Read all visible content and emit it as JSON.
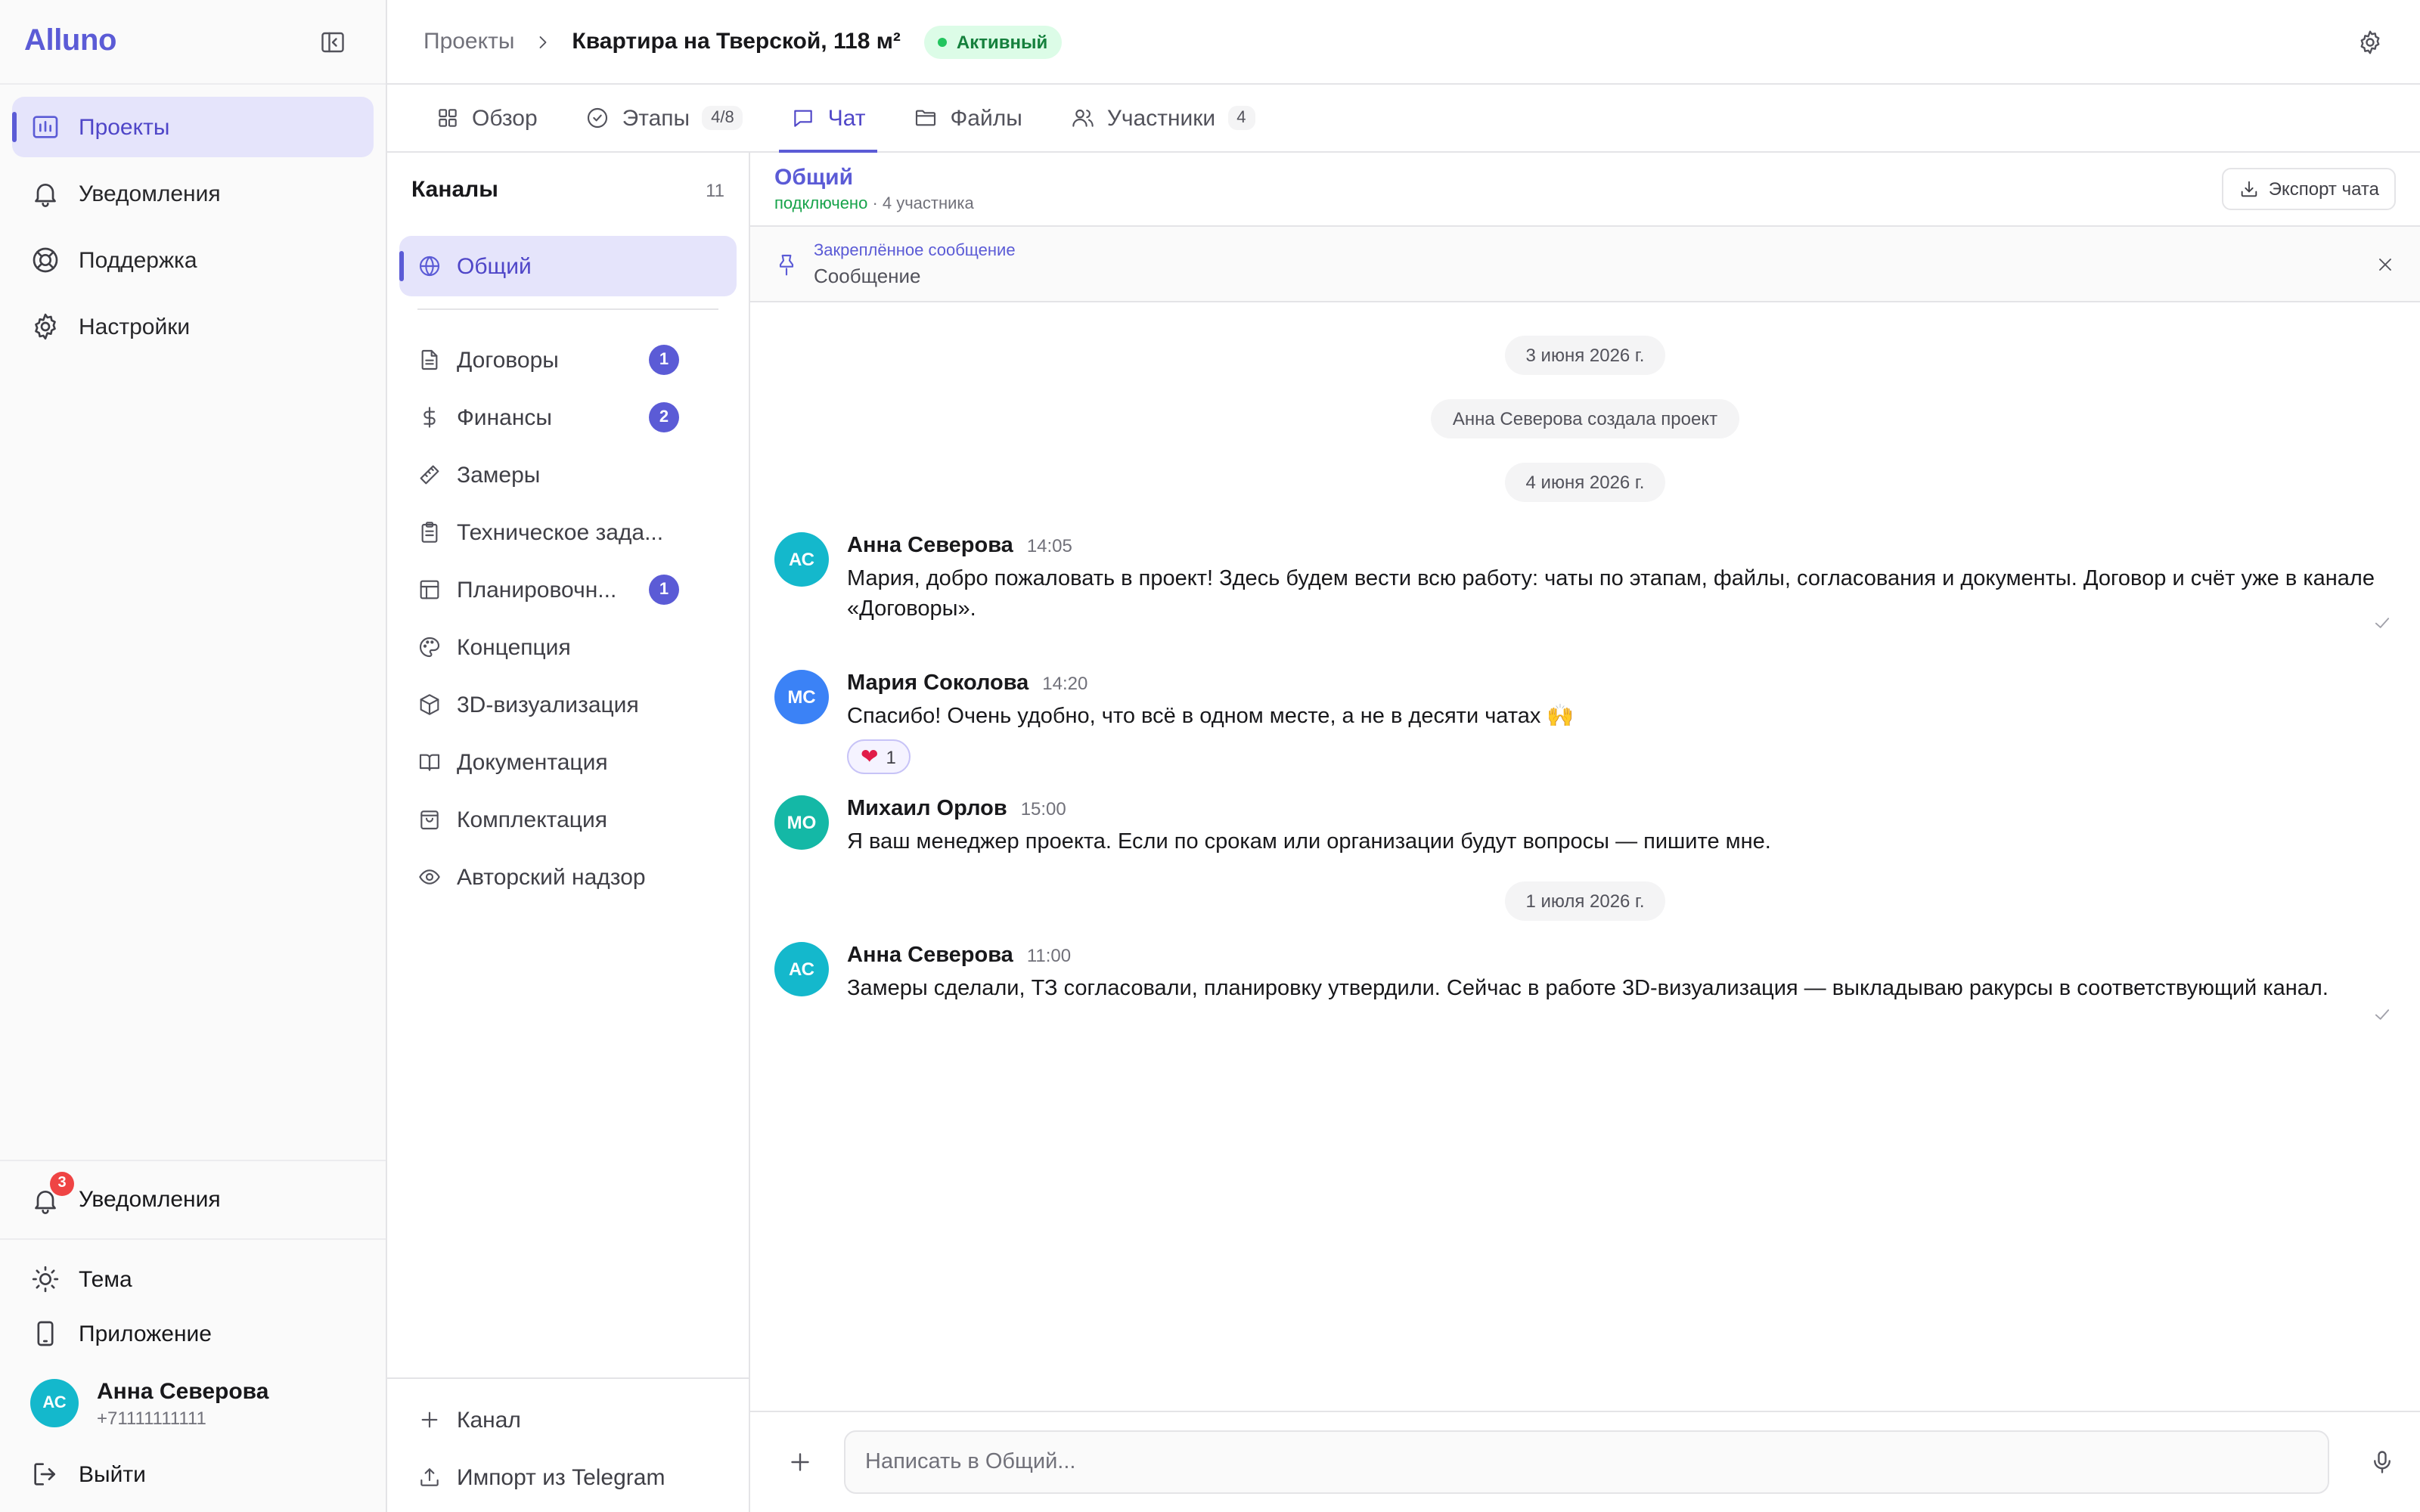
{
  "app": {
    "logo": "Alluno"
  },
  "sidebar": {
    "nav": [
      {
        "label": "Проекты",
        "icon": "chart-board-icon",
        "active": true
      },
      {
        "label": "Уведомления",
        "icon": "bell-icon"
      },
      {
        "label": "Поддержка",
        "icon": "lifebuoy-icon"
      },
      {
        "label": "Настройки",
        "icon": "gear-icon"
      }
    ],
    "notifications": {
      "label": "Уведомления",
      "count": "3"
    },
    "theme_label": "Тема",
    "app_label": "Приложение",
    "user": {
      "initials": "АС",
      "name": "Анна Северова",
      "phone": "+71111111111",
      "avatar_color": "#14b8cc"
    },
    "logout_label": "Выйти"
  },
  "header": {
    "breadcrumb_parent": "Проекты",
    "project_title": "Квартира на Тверской, 118 м²",
    "status": "Активный"
  },
  "tabs": [
    {
      "label": "Обзор",
      "icon": "grid-icon"
    },
    {
      "label": "Этапы",
      "icon": "check-circle-icon",
      "count": "4/8"
    },
    {
      "label": "Чат",
      "icon": "message-icon",
      "active": true
    },
    {
      "label": "Файлы",
      "icon": "folder-icon"
    },
    {
      "label": "Участники",
      "icon": "users-icon",
      "count": "4"
    }
  ],
  "channels": {
    "title": "Каналы",
    "count": "11",
    "items": [
      {
        "label": "Общий",
        "icon": "globe-icon",
        "active": true
      },
      {
        "label": "Договоры",
        "icon": "file-text-icon",
        "badge": "1"
      },
      {
        "label": "Финансы",
        "icon": "dollar-icon",
        "badge": "2"
      },
      {
        "label": "Замеры",
        "icon": "ruler-icon"
      },
      {
        "label": "Техническое зада...",
        "icon": "clipboard-icon"
      },
      {
        "label": "Планировочн...",
        "icon": "layout-icon",
        "badge": "1"
      },
      {
        "label": "Концепция",
        "icon": "palette-icon"
      },
      {
        "label": "3D-визуализация",
        "icon": "cube-icon"
      },
      {
        "label": "Документация",
        "icon": "book-icon"
      },
      {
        "label": "Комплектация",
        "icon": "bag-icon"
      },
      {
        "label": "Авторский надзор",
        "icon": "eye-icon"
      }
    ],
    "add_label": "Канал",
    "import_label": "Импорт из Telegram"
  },
  "chat": {
    "name": "Общий",
    "status": "подключено",
    "members": "· 4 участника",
    "export_label": "Экспорт чата",
    "pinned": {
      "label": "Закреплённое сообщение",
      "text": "Сообщение"
    },
    "system": {
      "date1": "3 июня 2026 г.",
      "created": "Анна Северова создала проект",
      "date2": "4 июня 2026 г.",
      "date3": "1 июля 2026 г."
    },
    "messages": [
      {
        "initials": "АС",
        "author": "Анна Северова",
        "time": "14:05",
        "color": "#14b8cc",
        "text": "Мария, добро пожаловать в проект! Здесь будем вести всю работу: чаты по этапам, файлы, согласования и документы. Договор и счёт уже в канале «Договоры»."
      },
      {
        "initials": "МС",
        "author": "Мария Соколова",
        "time": "14:20",
        "color": "#3b82f6",
        "text": "Спасибо! Очень удобно, что всё в одном месте, а не в десяти чатах 🙌",
        "reaction": {
          "emoji": "❤",
          "count": "1"
        }
      },
      {
        "initials": "МО",
        "author": "Михаил Орлов",
        "time": "15:00",
        "color": "#14b8a6",
        "text": "Я ваш менеджер проекта. Если по срокам или организации будут вопросы — пишите мне."
      },
      {
        "initials": "АС",
        "author": "Анна Северова",
        "time": "11:00",
        "color": "#14b8cc",
        "text": "Замеры сделали, ТЗ согласовали, планировку утвердили. Сейчас в работе 3D-визуализация — выкладываю ракурсы в соответствующий канал."
      }
    ],
    "composer_placeholder": "Написать в Общий..."
  }
}
